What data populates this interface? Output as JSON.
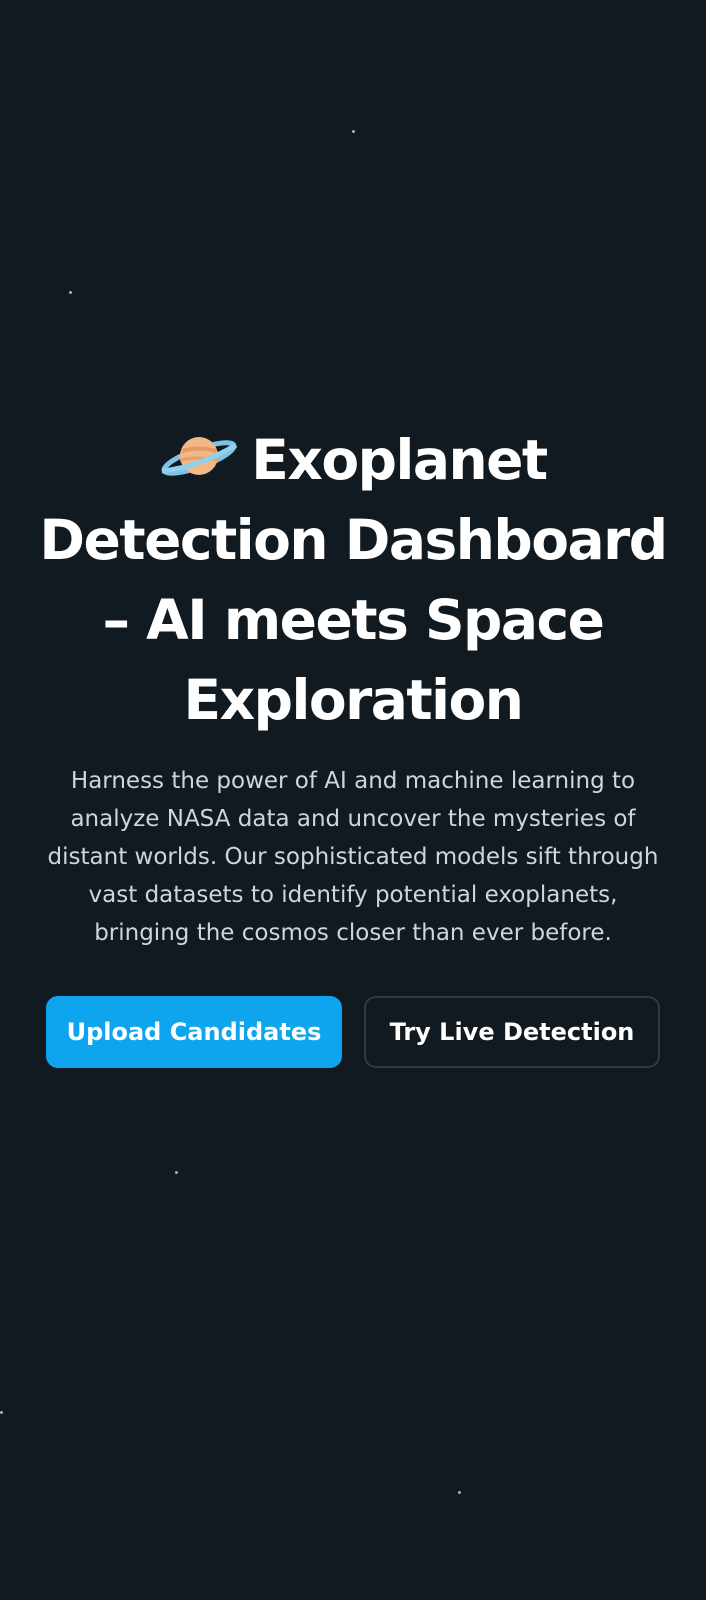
{
  "hero": {
    "icon": "ringed-planet-icon",
    "title": "Exoplanet Detection Dashboard – AI meets Space Exploration",
    "subtitle": "Harness the power of AI and machine learning to analyze NASA data and uncover the mysteries of distant worlds. Our sophisticated models sift through vast datasets to identify potential exoplanets, bringing the cosmos closer than ever before."
  },
  "actions": {
    "upload_label": "Upload Candidates",
    "live_label": "Try Live Detection"
  },
  "colors": {
    "background": "#111a21",
    "accent": "#0ea5ee",
    "text": "#ffffff",
    "muted_text": "#cdd6de",
    "button_border": "#2d3b47"
  }
}
